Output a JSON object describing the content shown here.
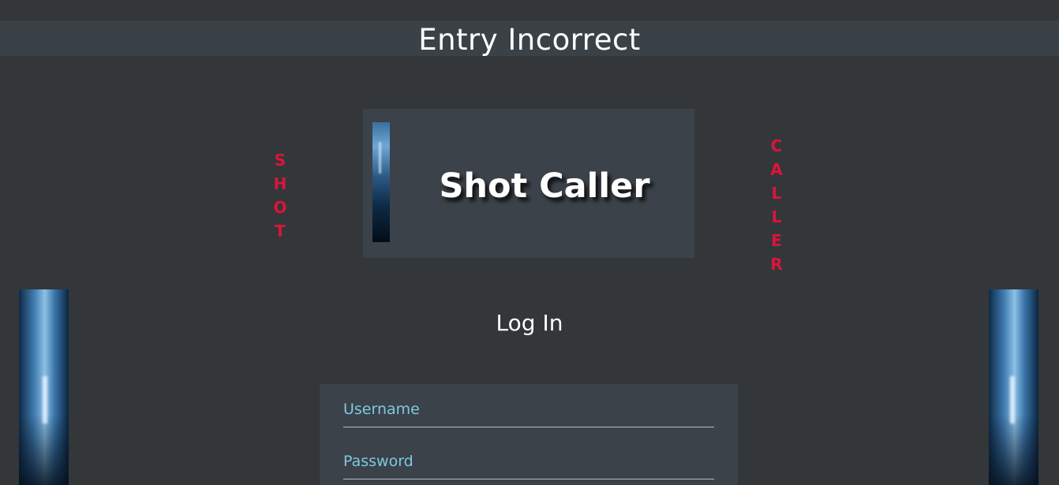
{
  "status": {
    "message": "Entry Incorrect"
  },
  "banner": {
    "title": "Shot Caller",
    "image_icon": "light-strip-image"
  },
  "side_words": {
    "left": [
      "S",
      "H",
      "O",
      "T"
    ],
    "right": [
      "C",
      "A",
      "L",
      "L",
      "E",
      "R"
    ]
  },
  "login": {
    "heading": "Log In",
    "username_placeholder": "Username",
    "password_placeholder": "Password"
  },
  "colors": {
    "background": "#333739",
    "panel": "#3b4249",
    "accent_red": "#dc143c",
    "placeholder_blue": "#7ec8e3"
  }
}
